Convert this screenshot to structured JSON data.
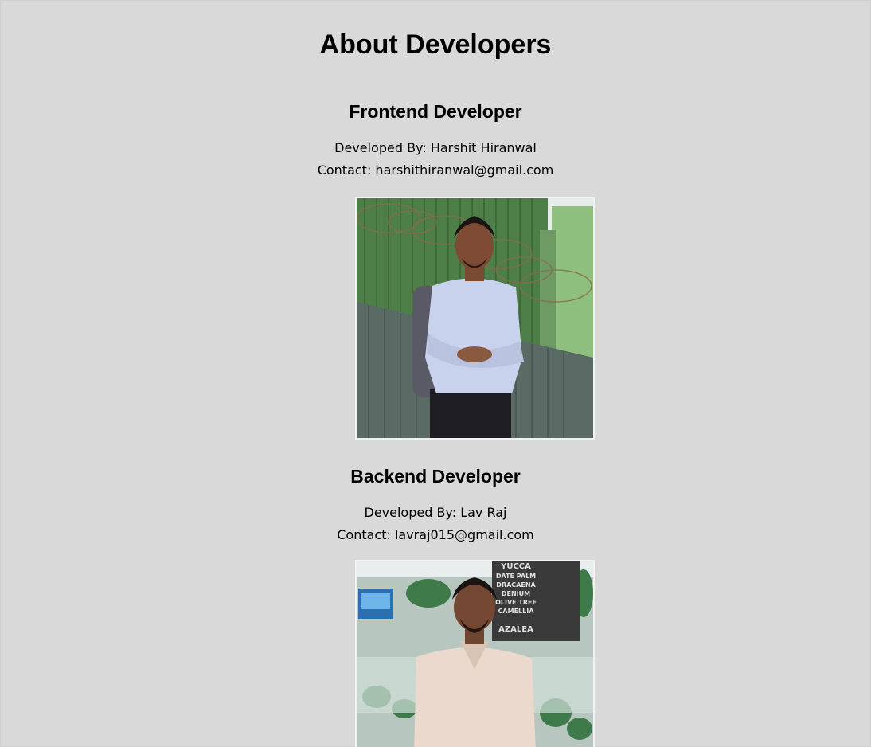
{
  "page": {
    "title": "About Developers"
  },
  "developers": [
    {
      "role": "Frontend Developer",
      "developed_by": "Developed By: Harshit Hiranwal",
      "contact": "Contact: harshithiranwal@gmail.com",
      "photo_icon": "person-photo"
    },
    {
      "role": "Backend Developer",
      "developed_by": "Developed By: Lav Raj",
      "contact": "Contact: lavraj015@gmail.com",
      "photo_icon": "person-photo",
      "photo_wall_text": [
        "YUCCA",
        "DATE PALM",
        "DRACAENA",
        "DENIUM",
        "OLIVE TREE",
        "CAMELLIA",
        "AZALEA"
      ]
    }
  ],
  "colors": {
    "background": "#d9d9d9",
    "photo_border": "#f2f2f2"
  }
}
